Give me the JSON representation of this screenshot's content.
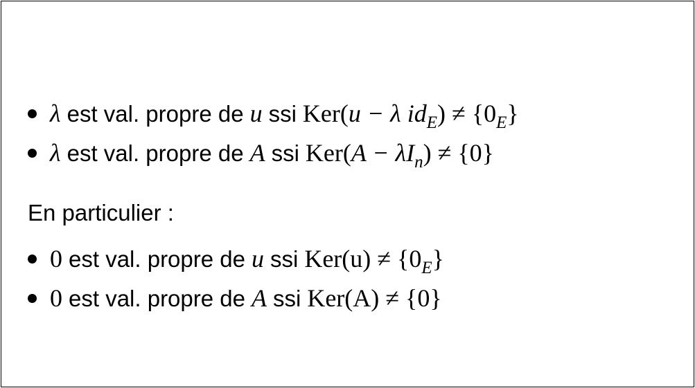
{
  "slide": {
    "items_top": [
      {
        "subject": "λ",
        "text": "est val. propre de",
        "object": "u",
        "connector": "ssi",
        "kernel_open": "Ker(",
        "kernel_arg": "u − λ id",
        "kernel_sub": "E",
        "kernel_close": ")",
        "neq": "≠",
        "set_open": "{0",
        "set_sub": "E",
        "set_close": "}"
      },
      {
        "subject": "λ",
        "text": "est val. propre de",
        "object": "A",
        "connector": "ssi",
        "kernel_open": "Ker(",
        "kernel_arg": "A − λI",
        "kernel_sub": "n",
        "kernel_close": ")",
        "neq": "≠",
        "set_open": "{0",
        "set_sub": "",
        "set_close": "}"
      }
    ],
    "heading": "En particulier :",
    "items_bottom": [
      {
        "subject": "0",
        "text": "est val. propre de",
        "object": "u",
        "connector": "ssi",
        "kernel": "Ker(u)",
        "neq": "≠",
        "set_open": "{0",
        "set_sub": "E",
        "set_close": "}"
      },
      {
        "subject": "0",
        "text": "est val. propre de",
        "object": "A",
        "connector": "ssi",
        "kernel": "Ker(A)",
        "neq": "≠",
        "set_open": "{0",
        "set_sub": "",
        "set_close": "}"
      }
    ]
  }
}
